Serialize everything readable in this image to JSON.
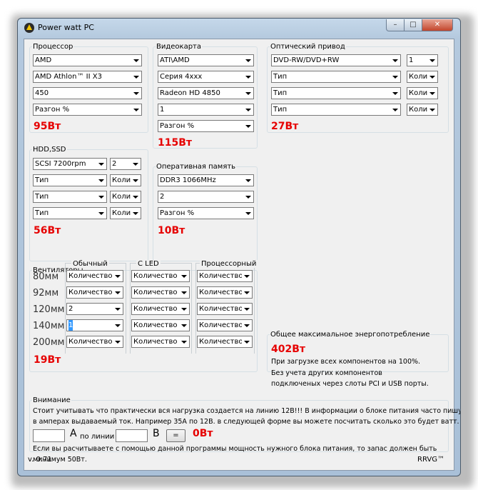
{
  "window": {
    "title": "Power watt PC",
    "min_label": "–",
    "max_label": "□",
    "close_label": "✕"
  },
  "cpu": {
    "legend": "Процессор",
    "manufacturer": "AMD",
    "model": "AMD Athlon™ II X3",
    "frequency": "450",
    "overclock": "Разгон %",
    "watt": "95Вт"
  },
  "gpu": {
    "legend": "Видеокарта",
    "vendor": "ATI\\AMD",
    "series": "Серия 4xxx",
    "model": "Radeon HD 4850",
    "count": "1",
    "overclock": "Разгон %",
    "watt": "115Вт"
  },
  "optical": {
    "legend": "Оптический привод",
    "rows": [
      {
        "type": "DVD-RW/DVD+RW",
        "count": "1"
      },
      {
        "type": "Тип",
        "count": "Коли"
      },
      {
        "type": "Тип",
        "count": "Коли"
      },
      {
        "type": "Тип",
        "count": "Коли"
      }
    ],
    "watt": "27Вт"
  },
  "hdd": {
    "legend": "HDD,SSD",
    "rows": [
      {
        "type": "SCSI 7200rpm",
        "count": "2"
      },
      {
        "type": "Тип",
        "count": "Коли"
      },
      {
        "type": "Тип",
        "count": "Коли"
      },
      {
        "type": "Тип",
        "count": "Коли"
      }
    ],
    "watt": "56Вт"
  },
  "ram": {
    "legend": "Оперативная память",
    "type": "DDR3 1066MHz",
    "count": "2",
    "overclock": "Разгон %",
    "watt": "10Вт"
  },
  "fans": {
    "legend": "Вентиляторы",
    "columns": [
      "Обычный",
      "С LED",
      "Процессорный"
    ],
    "sizes": [
      "80мм",
      "92мм",
      "120мм",
      "140мм",
      "200мм"
    ],
    "values": [
      [
        "Количество",
        "Количество",
        "Количество"
      ],
      [
        "Количество",
        "Количество",
        "Количество"
      ],
      [
        "2",
        "Количество",
        "Количество"
      ],
      [
        "1",
        "Количество",
        "Количество"
      ],
      [
        "Количество",
        "Количество",
        "Количество"
      ]
    ],
    "watt": "19Вт"
  },
  "total": {
    "legend": "Общее максимальное энергопотребление",
    "watt": "402Вт",
    "lines": [
      "При загрузке всех компонентов на 100%.",
      "Без учета других компонентов",
      "подключеных через слоты PCI и USB порты."
    ]
  },
  "attention": {
    "legend": "Внимание",
    "line1": "Стоит учитывать что практически вся нагрузка создается на линию 12В!!! В информации о блоке питания часто пишут",
    "line2": "в амперах выдаваемый ток. Например 35А по 12В.  в следующей форме вы можете посчитать сколько это будет ватт.",
    "a_label": "А",
    "line_label": "по линии",
    "v_label": "В",
    "eq_label": "=",
    "result": "0Вт",
    "line3": "Если вы расчитываете с помощью данной программы мощность нужного блока питания, то запас должен быть",
    "line4": "минимум 50Вт."
  },
  "footer": {
    "version": "v. 0.71",
    "author": "RRVG™"
  },
  "colors": {
    "watt": "#e60000",
    "client_bg": "#f0f0f0",
    "frame": "#b4c9de"
  }
}
